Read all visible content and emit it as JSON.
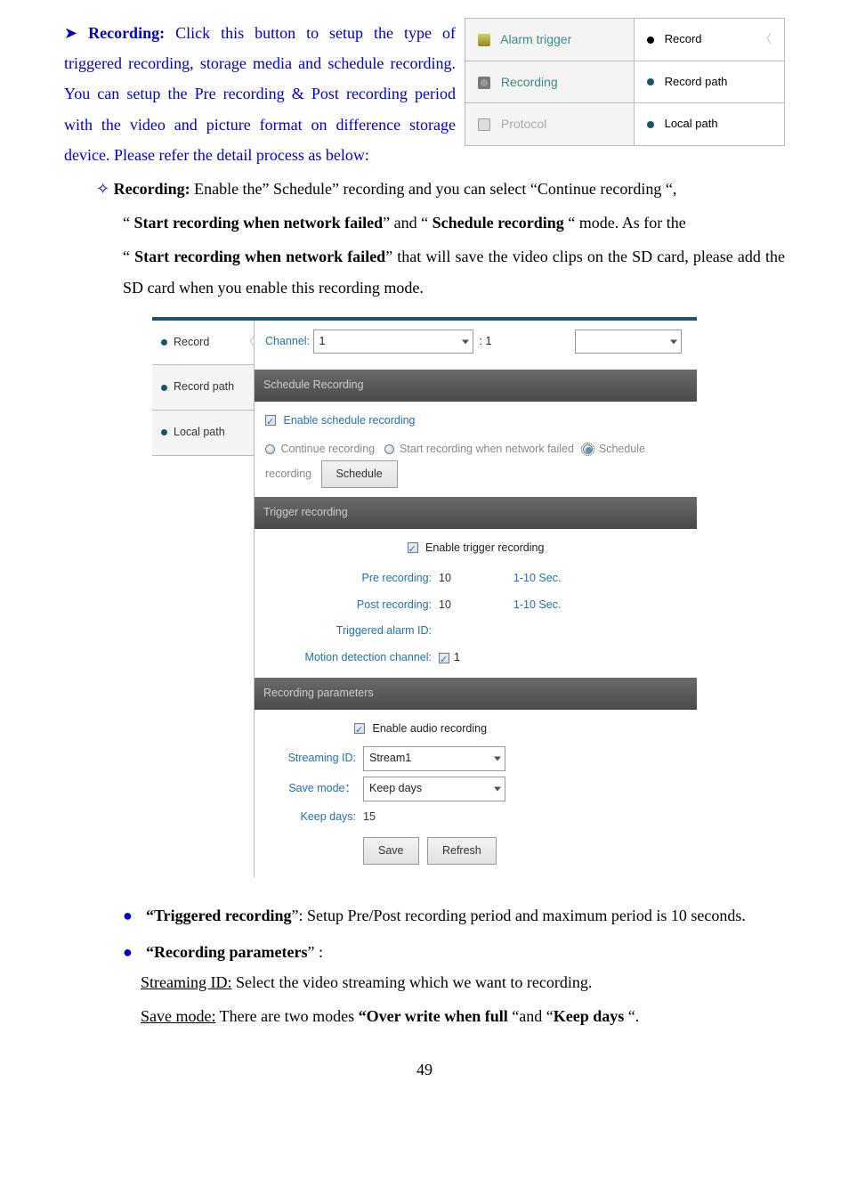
{
  "tabs": {
    "alarm_trigger": "Alarm trigger",
    "record": "Record",
    "recording": "Recording",
    "record_path": "Record path",
    "protocol": "Protocol",
    "local_path": "Local path"
  },
  "intro": {
    "heading": "Recording:",
    "line1": " Click this button to setup the type of triggered recording, storage media and schedule recording. You can setup the Pre recording & Post recording period with the video and picture format on difference storage device.    Please refer the detail process as below:",
    "diamond_heading": "Recording:",
    "diamond_line": " Enable the” Schedule” recording and you can select “Continue recording “,",
    "start_fail_1": "Start recording when network failed",
    "start_fail_mid": "” and “ ",
    "sched_rec": "Schedule recording",
    "asfor": " “ mode.      As for the",
    "start_fail_2": "Start recording when network failed",
    "start_fail_rest": "” that will save the video clips on the SD card, please add the SD card when you enable this recording mode."
  },
  "panel": {
    "sidebar": {
      "record": "Record",
      "record_path": "Record path",
      "local_path": "Local path"
    },
    "channel_label": "Channel:",
    "channel_value": "1",
    "channel_after": "1",
    "sec_schedule": "Schedule Recording",
    "enable_schedule": "Enable schedule recording",
    "opt_continue": "Continue recording",
    "opt_start_fail": "Start recording when network failed",
    "opt_sched": "Schedule recording",
    "btn_schedule": "Schedule",
    "sec_trigger": "Trigger recording",
    "enable_trigger": "Enable trigger recording",
    "pre_lbl": "Pre recording:",
    "pre_val": "10",
    "hint1": "1-10 Sec.",
    "post_lbl": "Post recording:",
    "post_val": "10",
    "hint2": "1-10 Sec.",
    "trig_alarm": "Triggered alarm ID:",
    "motion_lbl": "Motion detection channel:",
    "motion_val": "1",
    "sec_params": "Recording parameters",
    "enable_audio": "Enable audio recording",
    "stream_lbl": "Streaming ID:",
    "stream_val": "Stream1",
    "savemode_lbl": "Save mode：",
    "savemode_val": "Keep days",
    "keepdays_lbl": "Keep days:",
    "keepdays_val": "15",
    "btn_save": "Save",
    "btn_refresh": "Refresh"
  },
  "after": {
    "trig_head": "“Triggered recording",
    "trig_rest": "”: Setup Pre/Post recording period and maximum period is 10 seconds.",
    "param_head": "“Recording parameters",
    "param_rest": "” :",
    "stream_u": "Streaming ID:",
    "stream_rest": " Select the video streaming which we want to recording.",
    "save_u": "Save mode:",
    "save_rest_1": " There are two modes ",
    "save_bold1": "“Over write when full",
    "save_mid": " “and “",
    "save_bold2": "Keep days",
    "save_end": " “."
  },
  "page": "49"
}
